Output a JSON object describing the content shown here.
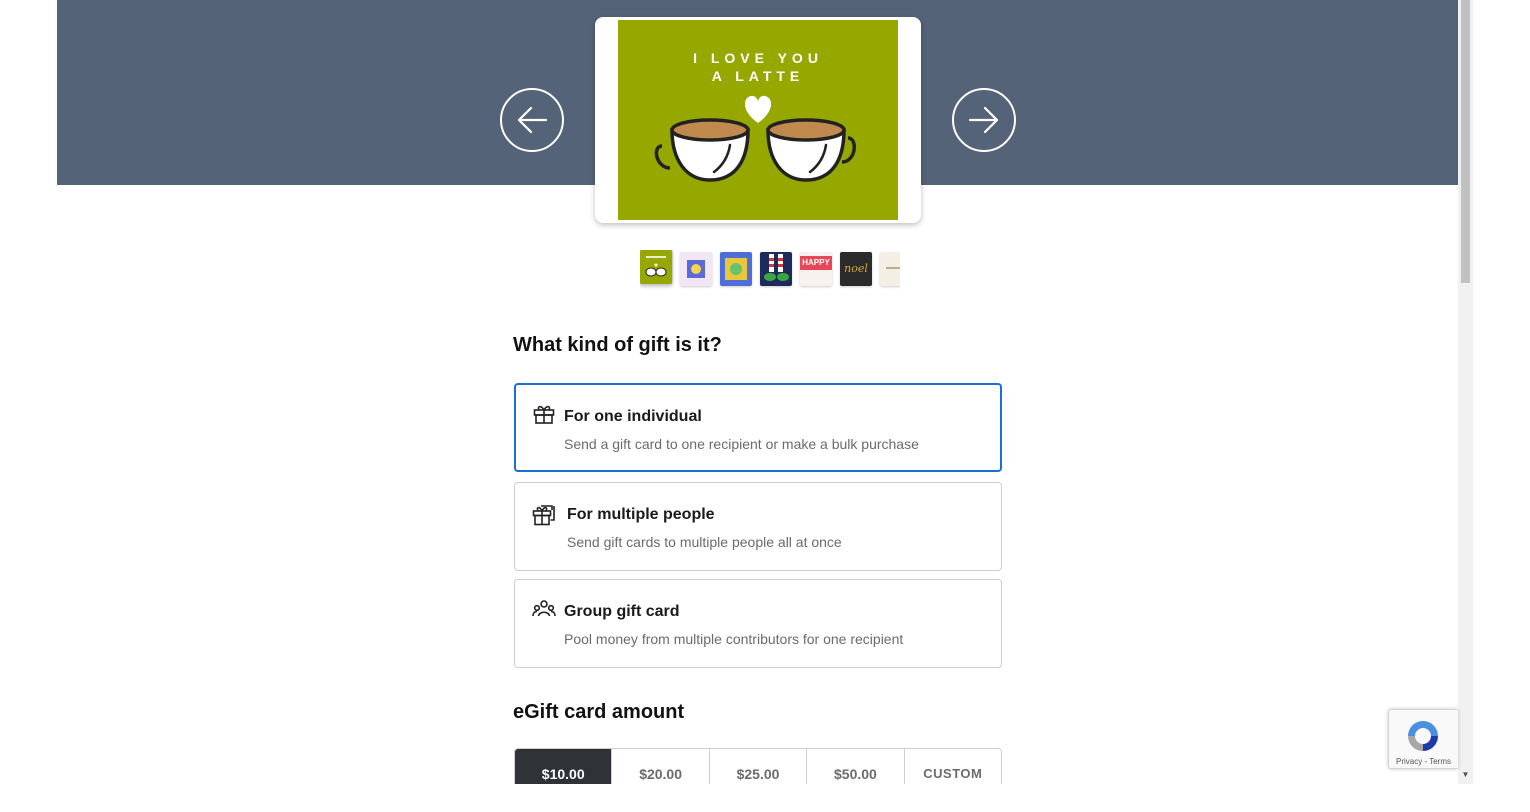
{
  "hero": {
    "card_line1": "I LOVE YOU",
    "card_line2": "A LATTE",
    "card_bg_color": "#96a800",
    "band_color": "#546377"
  },
  "carousel": {
    "prev_icon": "arrow-left-icon",
    "next_icon": "arrow-right-icon",
    "thumbnails": [
      {
        "name": "latte-love",
        "selected": true
      },
      {
        "name": "pink-sticker"
      },
      {
        "name": "blue-sticker"
      },
      {
        "name": "elf-stockings"
      },
      {
        "name": "happy-holidays-pink"
      },
      {
        "name": "noel-gold"
      },
      {
        "name": "cream-card"
      }
    ],
    "thumb_texts": {
      "happy": "HAPPY",
      "noel": "noel"
    }
  },
  "gift_kind": {
    "title": "What kind of gift is it?",
    "options": [
      {
        "title": "For one individual",
        "desc": "Send a gift card to one recipient or make a bulk purchase",
        "icon": "gift-icon",
        "selected": true
      },
      {
        "title": "For multiple people",
        "desc": "Send gift cards to multiple people all at once",
        "icon": "gift-stack-icon",
        "selected": false
      },
      {
        "title": "Group gift card",
        "desc": "Pool money from multiple contributors for one recipient",
        "icon": "group-icon",
        "selected": false
      }
    ]
  },
  "amount": {
    "title": "eGift card amount",
    "options": [
      "$10.00",
      "$20.00",
      "$25.00",
      "$50.00",
      "CUSTOM"
    ],
    "selected_index": 0
  },
  "recaptcha": {
    "links": "Privacy - Terms"
  },
  "colors": {
    "selected_border": "#1a6fd6",
    "selected_amount_bg": "#2f3337"
  }
}
